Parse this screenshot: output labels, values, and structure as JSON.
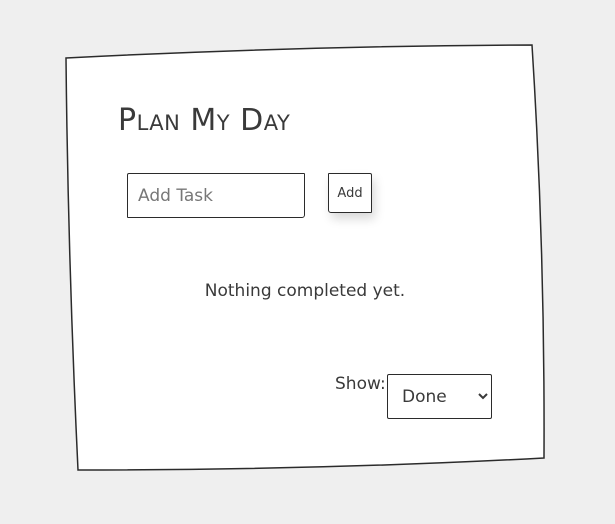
{
  "app": {
    "title": "Plan My Day"
  },
  "task_form": {
    "input_value": "",
    "input_placeholder": "Add Task",
    "add_label": "Add"
  },
  "task_list": {
    "empty_message": "Nothing completed yet."
  },
  "filter": {
    "label": "Show:",
    "selected": "Done"
  },
  "colors": {
    "background": "#efefef",
    "card": "#ffffff",
    "ink": "#2b2b2b"
  }
}
